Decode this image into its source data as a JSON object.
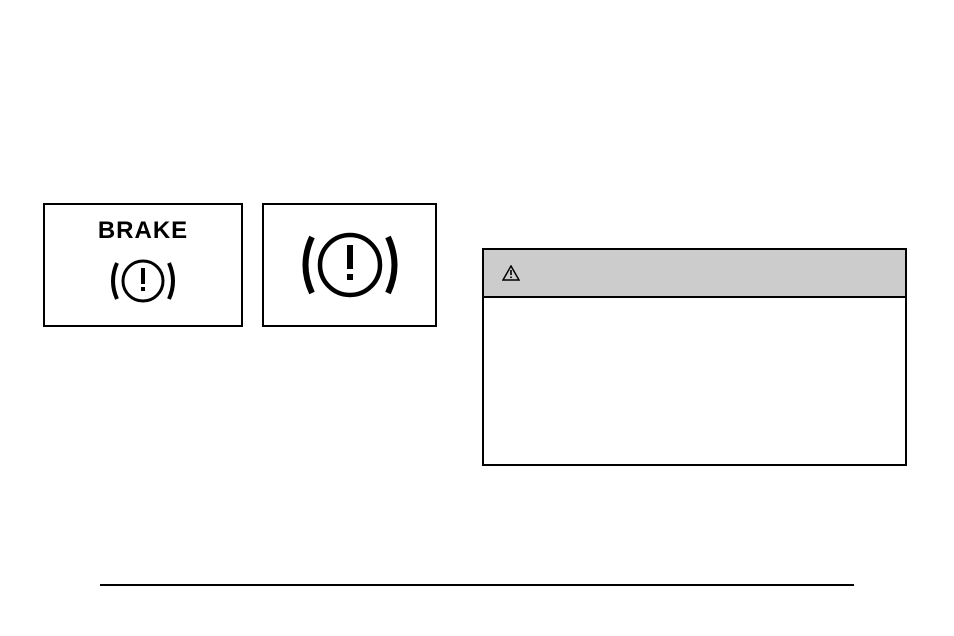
{
  "brake_box_1": {
    "label": "BRAKE"
  }
}
